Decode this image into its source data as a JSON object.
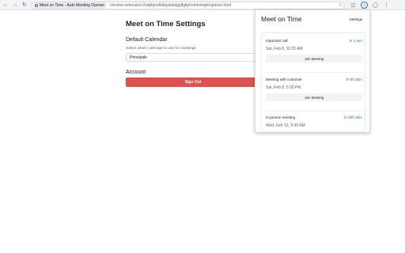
{
  "browser": {
    "tab_title": "Meet on Time - Auto Meeting Opener",
    "url": "chrome-extension://odpbjmdkbkpokkdgglfgllphomhimigh/options.html"
  },
  "settings": {
    "title": "Meet on Time Settings",
    "calendar_heading": "Default Calendar",
    "calendar_help": "Select which calendar to use for meetings",
    "calendar_value": "Principale",
    "account_heading": "Account",
    "signout_label": "Sign Out",
    "signout_color": "#d9534f"
  },
  "popup": {
    "title": "Meet on Time",
    "settings_label": "Settings",
    "meetings": [
      {
        "name": "Important call",
        "countdown": "In 1 min",
        "date": "Sat, Feb 8, 11:55 AM",
        "join_label": "Join Meeting"
      },
      {
        "name": "Meeting with customer",
        "countdown": "In 5h 35m",
        "date": "Sat, Feb 8, 5:30 PM",
        "join_label": "Join Meeting"
      },
      {
        "name": "In-person meeting",
        "countdown": "In 93h 35m",
        "date": "Wed, Feb 12, 9:30 AM"
      }
    ],
    "accent_color": "#1a73e8"
  }
}
